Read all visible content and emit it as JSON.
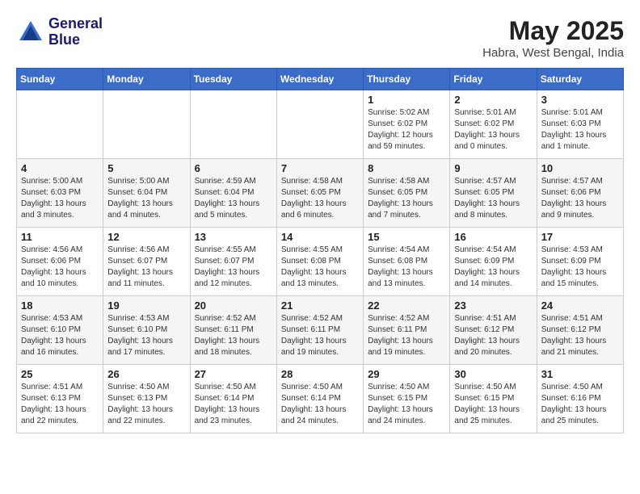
{
  "header": {
    "logo_line1": "General",
    "logo_line2": "Blue",
    "month_title": "May 2025",
    "location": "Habra, West Bengal, India"
  },
  "weekdays": [
    "Sunday",
    "Monday",
    "Tuesday",
    "Wednesday",
    "Thursday",
    "Friday",
    "Saturday"
  ],
  "weeks": [
    [
      {
        "day": "",
        "info": ""
      },
      {
        "day": "",
        "info": ""
      },
      {
        "day": "",
        "info": ""
      },
      {
        "day": "",
        "info": ""
      },
      {
        "day": "1",
        "info": "Sunrise: 5:02 AM\nSunset: 6:02 PM\nDaylight: 12 hours\nand 59 minutes."
      },
      {
        "day": "2",
        "info": "Sunrise: 5:01 AM\nSunset: 6:02 PM\nDaylight: 13 hours\nand 0 minutes."
      },
      {
        "day": "3",
        "info": "Sunrise: 5:01 AM\nSunset: 6:03 PM\nDaylight: 13 hours\nand 1 minute."
      }
    ],
    [
      {
        "day": "4",
        "info": "Sunrise: 5:00 AM\nSunset: 6:03 PM\nDaylight: 13 hours\nand 3 minutes."
      },
      {
        "day": "5",
        "info": "Sunrise: 5:00 AM\nSunset: 6:04 PM\nDaylight: 13 hours\nand 4 minutes."
      },
      {
        "day": "6",
        "info": "Sunrise: 4:59 AM\nSunset: 6:04 PM\nDaylight: 13 hours\nand 5 minutes."
      },
      {
        "day": "7",
        "info": "Sunrise: 4:58 AM\nSunset: 6:05 PM\nDaylight: 13 hours\nand 6 minutes."
      },
      {
        "day": "8",
        "info": "Sunrise: 4:58 AM\nSunset: 6:05 PM\nDaylight: 13 hours\nand 7 minutes."
      },
      {
        "day": "9",
        "info": "Sunrise: 4:57 AM\nSunset: 6:05 PM\nDaylight: 13 hours\nand 8 minutes."
      },
      {
        "day": "10",
        "info": "Sunrise: 4:57 AM\nSunset: 6:06 PM\nDaylight: 13 hours\nand 9 minutes."
      }
    ],
    [
      {
        "day": "11",
        "info": "Sunrise: 4:56 AM\nSunset: 6:06 PM\nDaylight: 13 hours\nand 10 minutes."
      },
      {
        "day": "12",
        "info": "Sunrise: 4:56 AM\nSunset: 6:07 PM\nDaylight: 13 hours\nand 11 minutes."
      },
      {
        "day": "13",
        "info": "Sunrise: 4:55 AM\nSunset: 6:07 PM\nDaylight: 13 hours\nand 12 minutes."
      },
      {
        "day": "14",
        "info": "Sunrise: 4:55 AM\nSunset: 6:08 PM\nDaylight: 13 hours\nand 13 minutes."
      },
      {
        "day": "15",
        "info": "Sunrise: 4:54 AM\nSunset: 6:08 PM\nDaylight: 13 hours\nand 13 minutes."
      },
      {
        "day": "16",
        "info": "Sunrise: 4:54 AM\nSunset: 6:09 PM\nDaylight: 13 hours\nand 14 minutes."
      },
      {
        "day": "17",
        "info": "Sunrise: 4:53 AM\nSunset: 6:09 PM\nDaylight: 13 hours\nand 15 minutes."
      }
    ],
    [
      {
        "day": "18",
        "info": "Sunrise: 4:53 AM\nSunset: 6:10 PM\nDaylight: 13 hours\nand 16 minutes."
      },
      {
        "day": "19",
        "info": "Sunrise: 4:53 AM\nSunset: 6:10 PM\nDaylight: 13 hours\nand 17 minutes."
      },
      {
        "day": "20",
        "info": "Sunrise: 4:52 AM\nSunset: 6:11 PM\nDaylight: 13 hours\nand 18 minutes."
      },
      {
        "day": "21",
        "info": "Sunrise: 4:52 AM\nSunset: 6:11 PM\nDaylight: 13 hours\nand 19 minutes."
      },
      {
        "day": "22",
        "info": "Sunrise: 4:52 AM\nSunset: 6:11 PM\nDaylight: 13 hours\nand 19 minutes."
      },
      {
        "day": "23",
        "info": "Sunrise: 4:51 AM\nSunset: 6:12 PM\nDaylight: 13 hours\nand 20 minutes."
      },
      {
        "day": "24",
        "info": "Sunrise: 4:51 AM\nSunset: 6:12 PM\nDaylight: 13 hours\nand 21 minutes."
      }
    ],
    [
      {
        "day": "25",
        "info": "Sunrise: 4:51 AM\nSunset: 6:13 PM\nDaylight: 13 hours\nand 22 minutes."
      },
      {
        "day": "26",
        "info": "Sunrise: 4:50 AM\nSunset: 6:13 PM\nDaylight: 13 hours\nand 22 minutes."
      },
      {
        "day": "27",
        "info": "Sunrise: 4:50 AM\nSunset: 6:14 PM\nDaylight: 13 hours\nand 23 minutes."
      },
      {
        "day": "28",
        "info": "Sunrise: 4:50 AM\nSunset: 6:14 PM\nDaylight: 13 hours\nand 24 minutes."
      },
      {
        "day": "29",
        "info": "Sunrise: 4:50 AM\nSunset: 6:15 PM\nDaylight: 13 hours\nand 24 minutes."
      },
      {
        "day": "30",
        "info": "Sunrise: 4:50 AM\nSunset: 6:15 PM\nDaylight: 13 hours\nand 25 minutes."
      },
      {
        "day": "31",
        "info": "Sunrise: 4:50 AM\nSunset: 6:16 PM\nDaylight: 13 hours\nand 25 minutes."
      }
    ]
  ]
}
